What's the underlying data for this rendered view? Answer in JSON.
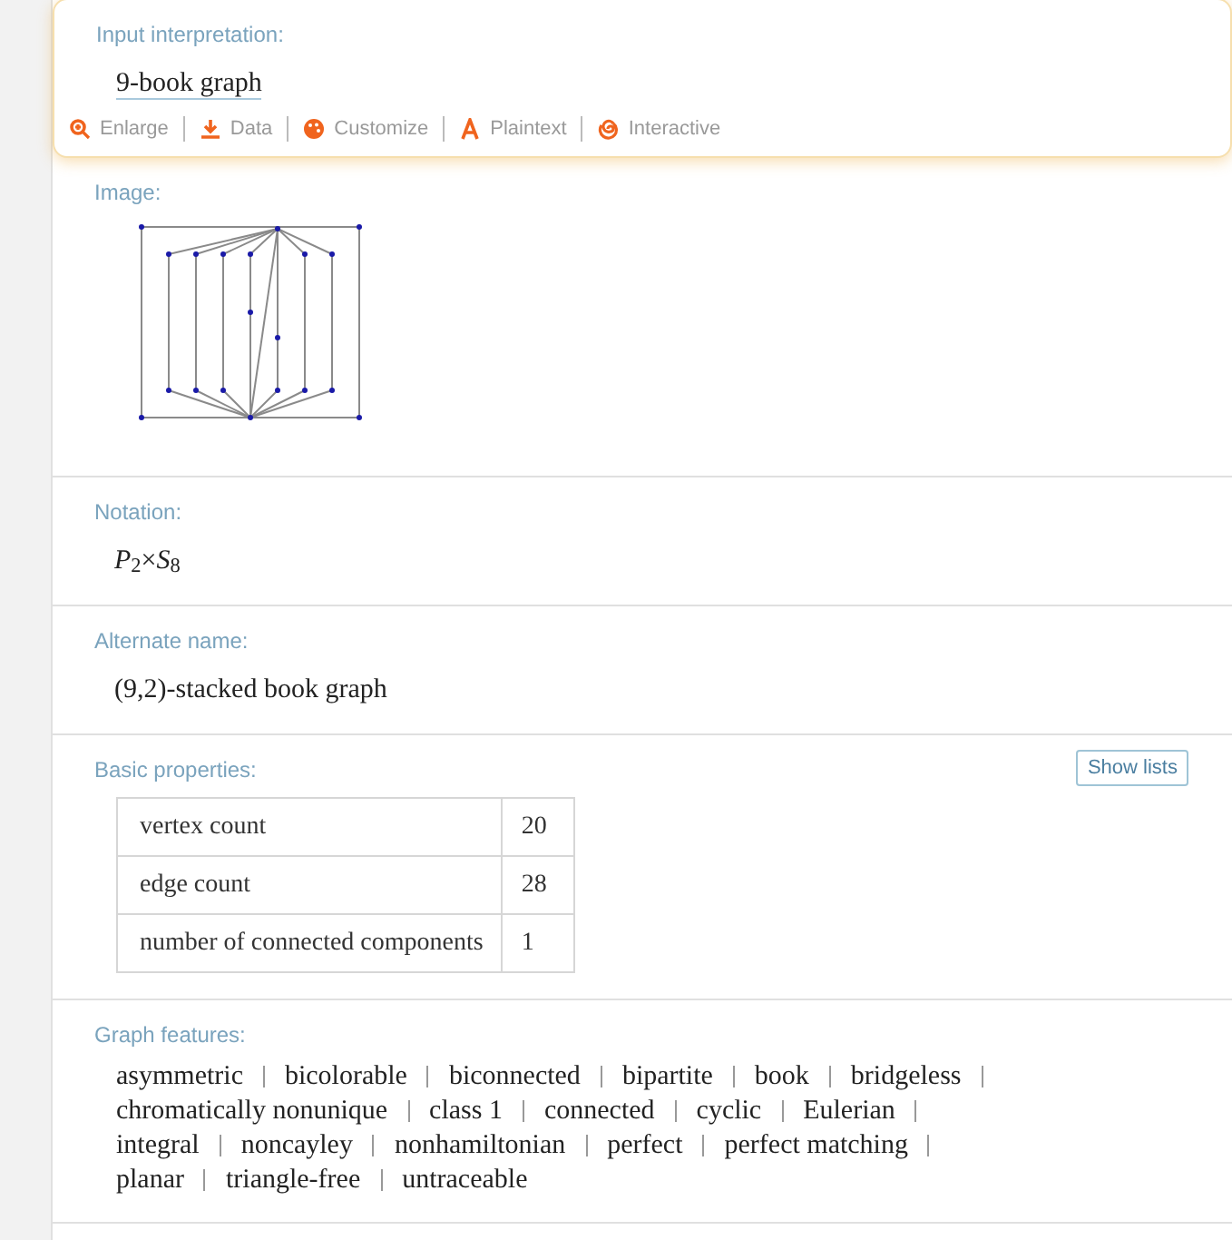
{
  "input_interpretation": {
    "label": "Input interpretation:",
    "value": "9-book graph",
    "actions": [
      "Enlarge",
      "Data",
      "Customize",
      "Plaintext",
      "Interactive"
    ]
  },
  "pods": [
    {
      "kind": "image",
      "label": "Image:"
    },
    {
      "kind": "math",
      "label": "Notation:",
      "value": "*P*$_{2}$×*S*$_{8}$"
    },
    {
      "kind": "text",
      "label": "Alternate name:",
      "value": "(9,2)-stacked book graph"
    },
    {
      "kind": "table",
      "label": "Basic properties:",
      "button": "Show lists",
      "rows": [
        [
          "vertex count",
          "20"
        ],
        [
          "edge count",
          "28"
        ],
        [
          "number of connected components",
          "1"
        ]
      ]
    },
    {
      "kind": "features",
      "label": "Graph features:",
      "items": [
        "asymmetric",
        "bicolorable",
        "biconnected",
        "bipartite",
        "book",
        "bridgeless",
        "chromatically nonunique",
        "class 1",
        "connected",
        "cyclic",
        "Eulerian",
        "integral",
        "noncayley",
        "nonhamiltonian",
        "perfect",
        "perfect matching",
        "planar",
        "triangle-free",
        "untraceable"
      ]
    }
  ]
}
